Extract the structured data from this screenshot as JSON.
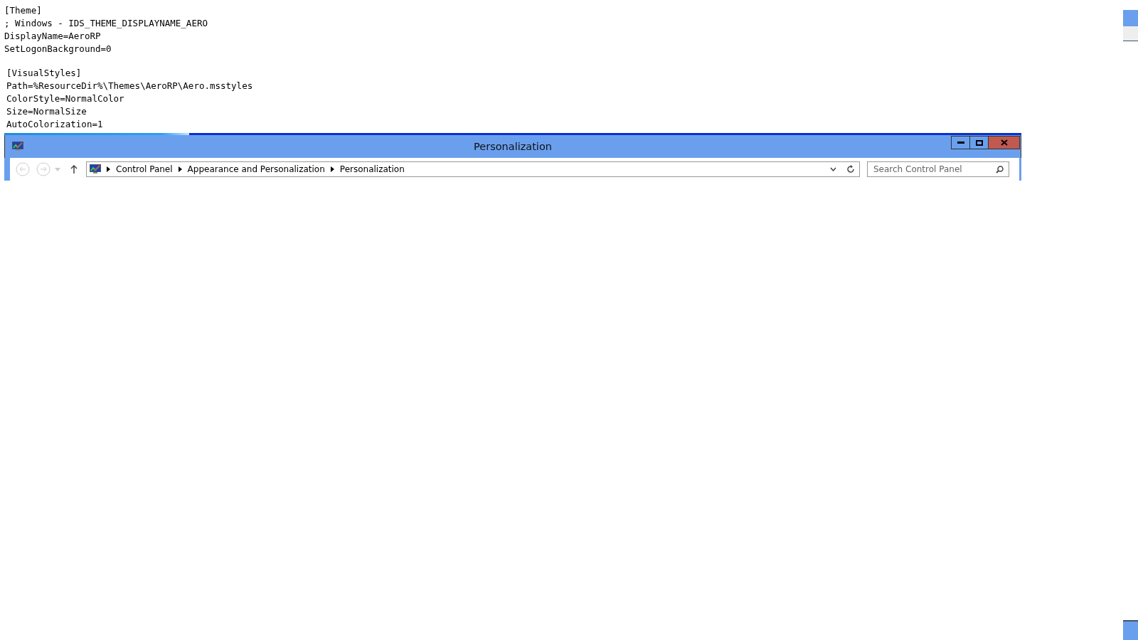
{
  "text_file": {
    "lines": [
      {
        "text": "[Theme]",
        "indent": false
      },
      {
        "text": "; Windows - IDS_THEME_DISPLAYNAME_AERO",
        "indent": false
      },
      {
        "text": "DisplayName=AeroRP",
        "indent": false
      },
      {
        "text": "SetLogonBackground=0",
        "indent": false
      },
      {
        "text": "[VisualStyles]",
        "indent": true
      },
      {
        "text": "Path=%ResourceDir%\\Themes\\AeroRP\\Aero.msstyles",
        "indent": true
      },
      {
        "text": "ColorStyle=NormalColor",
        "indent": true
      },
      {
        "text": "Size=NormalSize",
        "indent": true
      },
      {
        "text": "AutoColorization=1",
        "indent": true
      }
    ]
  },
  "window": {
    "title": "Personalization",
    "breadcrumb": [
      "Control Panel",
      "Appearance and Personalization",
      "Personalization"
    ],
    "search": {
      "placeholder": "Search Control Panel"
    }
  }
}
